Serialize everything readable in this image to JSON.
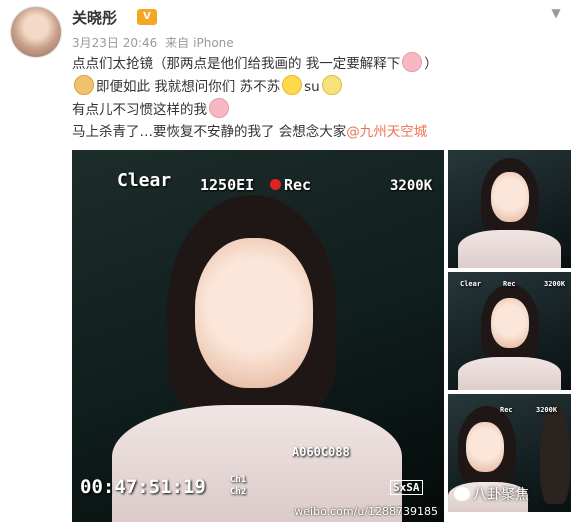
{
  "post": {
    "username": "关晓彤",
    "badge": "V",
    "meta": {
      "date": "3月23日 20:46",
      "source_prefix": "来自",
      "source": "iPhone"
    },
    "lines": [
      {
        "text": "点点们太抢镜（那两点是他们给我画的 我一定要解释下",
        "tail": "）"
      },
      {
        "text_a": "即便如此 我就想问你们 苏不苏",
        "text_b": "su"
      },
      {
        "text": "有点儿不习惯这样的我"
      },
      {
        "text": "马上杀青了…要恢复不安静的我了 会想念大家",
        "mention": "@九州天空城"
      }
    ]
  },
  "photos": {
    "main": {
      "clear": "Clear",
      "iso": "1250EI",
      "rec": "Rec",
      "temp": "3200K",
      "clip": "A060C088",
      "timecode": "00:47:51:19",
      "ch1": "Ch1",
      "ch2": "Ch2",
      "sxs": "SxSA",
      "watermark": "weibo.com/u/1288739185"
    },
    "side2": {
      "clear": "Clear",
      "rec": "Rec",
      "temp": "3200K"
    },
    "side3": {
      "rec": "Rec",
      "temp": "3200K"
    },
    "overlay_logo": "八卦聚焦"
  },
  "colors": {
    "mention": "#eb7350",
    "rec_dot": "#e0231f",
    "badge": "#f5a623"
  },
  "icons": [
    "chevron-down-icon",
    "vip-badge-icon",
    "pig-emoji-icon",
    "face-emoji-icon",
    "wechat-icon",
    "rec-dot-icon"
  ]
}
